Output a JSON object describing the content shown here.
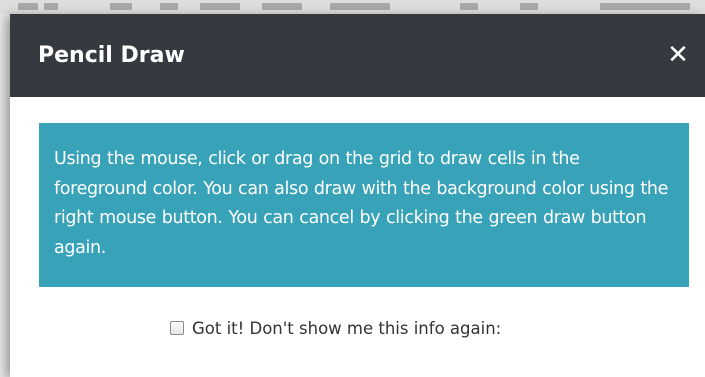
{
  "dialog": {
    "title": "Pencil Draw",
    "close_glyph": "✕",
    "close_icon": "close-icon",
    "info_text": "Using the mouse, click or drag on the grid to draw cells in the foreground color. You can also draw with the background color using the right mouse button. You can cancel by clicking the green draw button again.",
    "info_color": "#37a2b8",
    "header_color": "#343a40",
    "dont_show_label": "Got it! Don't show me this info again:",
    "dont_show_checked": false
  }
}
